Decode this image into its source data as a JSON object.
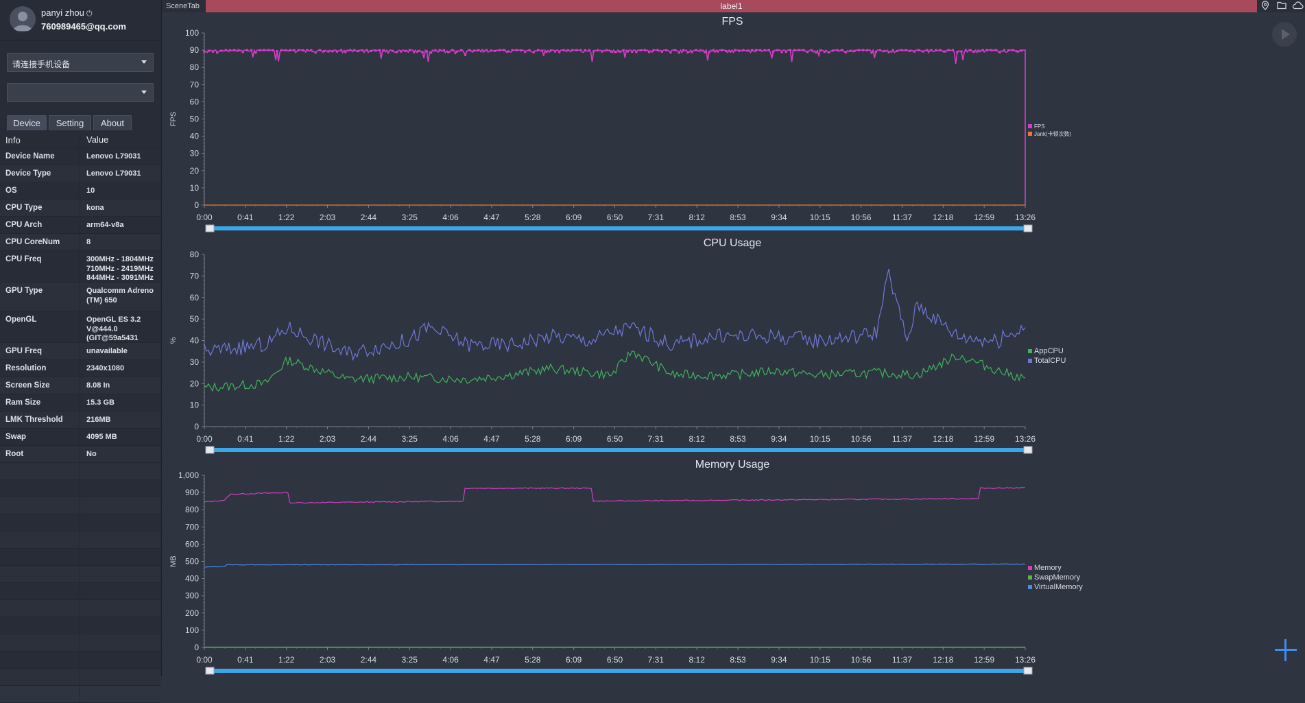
{
  "profile": {
    "username": "panyi zhou",
    "email": "760989465@qq.com"
  },
  "device_select": {
    "value": "请连接手机设备"
  },
  "app_select": {
    "value": ""
  },
  "tabs": [
    {
      "label": "Device",
      "active": true
    },
    {
      "label": "Setting",
      "active": false
    },
    {
      "label": "About",
      "active": false
    }
  ],
  "info_table": {
    "header": {
      "key": "Info",
      "value": "Value"
    },
    "rows": [
      {
        "key": "Device Name",
        "value": [
          "Lenovo L79031"
        ]
      },
      {
        "key": "Device Type",
        "value": [
          "Lenovo L79031"
        ]
      },
      {
        "key": "OS",
        "value": [
          "10"
        ]
      },
      {
        "key": "CPU Type",
        "value": [
          "kona"
        ]
      },
      {
        "key": "CPU Arch",
        "value": [
          "arm64-v8a"
        ]
      },
      {
        "key": "CPU CoreNum",
        "value": [
          "8"
        ]
      },
      {
        "key": "CPU Freq",
        "value": [
          "300MHz - 1804MHz",
          "710MHz - 2419MHz",
          "844MHz - 3091MHz"
        ]
      },
      {
        "key": "GPU Type",
        "value": [
          "Qualcomm Adreno",
          "(TM) 650"
        ]
      },
      {
        "key": "OpenGL",
        "value": [
          "OpenGL ES 3.2",
          "V@444.0",
          "(GIT@59a5431"
        ]
      },
      {
        "key": "GPU Freq",
        "value": [
          "unavailable"
        ]
      },
      {
        "key": "Resolution",
        "value": [
          "2340x1080"
        ]
      },
      {
        "key": "Screen Size",
        "value": [
          "8.08 In"
        ]
      },
      {
        "key": "Ram Size",
        "value": [
          "15.3 GB"
        ]
      },
      {
        "key": "LMK Threshold",
        "value": [
          "216MB"
        ]
      },
      {
        "key": "Swap",
        "value": [
          "4095 MB"
        ]
      },
      {
        "key": "Root",
        "value": [
          "No"
        ]
      }
    ]
  },
  "topbar": {
    "scene_tab": "SceneTab",
    "label": "label1"
  },
  "icons": {
    "location": "location-pin-icon",
    "folder": "folder-icon",
    "cloud": "cloud-icon",
    "play": "play-icon",
    "add": "plus-icon"
  },
  "colors": {
    "label_bar": "#a74a5c",
    "fps": "#d63cc8",
    "jank": "#e8793a",
    "app_cpu": "#3fb35a",
    "total_cpu": "#6f78d8",
    "memory": "#d23fc0",
    "swap": "#5ab83c",
    "virtual": "#4a8de6",
    "scrollbar": "#3aa8e6"
  },
  "chart_data": [
    {
      "type": "line",
      "title": "FPS",
      "ylabel": "FPS",
      "ylim": [
        0,
        100
      ],
      "yticks": [
        "100",
        "90",
        "80",
        "70",
        "60",
        "50",
        "40",
        "30",
        "20",
        "10",
        "0"
      ],
      "xticks": [
        "0:00",
        "0:41",
        "1:22",
        "2:03",
        "2:44",
        "3:25",
        "4:06",
        "4:47",
        "5:28",
        "6:09",
        "6:50",
        "7:31",
        "8:12",
        "8:53",
        "9:34",
        "10:15",
        "10:56",
        "11:37",
        "12:18",
        "12:59",
        "13:26"
      ],
      "x_range_seconds": [
        0,
        806
      ],
      "series": [
        {
          "name": "FPS",
          "value_mean": 90,
          "end_value": 0,
          "markers": true
        },
        {
          "name": "Jank(卡顿次数)",
          "value_mean": 0
        }
      ],
      "legend": "right"
    },
    {
      "type": "line",
      "title": "CPU Usage",
      "ylabel": "%",
      "ylim": [
        0,
        80
      ],
      "yticks": [
        "80",
        "70",
        "60",
        "50",
        "40",
        "30",
        "20",
        "10",
        "0"
      ],
      "xticks": [
        "0:00",
        "0:41",
        "1:22",
        "2:03",
        "2:44",
        "3:25",
        "4:06",
        "4:47",
        "5:28",
        "6:09",
        "6:50",
        "7:31",
        "8:12",
        "8:53",
        "9:34",
        "10:15",
        "10:56",
        "11:37",
        "12:18",
        "12:59",
        "13:26"
      ],
      "x_range_seconds": [
        0,
        806
      ],
      "series": [
        {
          "name": "AppCPU",
          "x": [
            0,
            60,
            82,
            140,
            200,
            260,
            300,
            340,
            400,
            420,
            460,
            520,
            560,
            600,
            660,
            700,
            740,
            780,
            806
          ],
          "values": [
            18,
            20,
            31,
            22,
            23,
            22,
            24,
            27,
            24,
            35,
            24,
            24,
            26,
            24,
            25,
            24,
            33,
            26,
            22
          ]
        },
        {
          "name": "TotalCPU",
          "x": [
            0,
            60,
            82,
            140,
            200,
            220,
            260,
            300,
            340,
            380,
            400,
            420,
            460,
            500,
            560,
            600,
            640,
            660,
            672,
            690,
            700,
            740,
            780,
            806
          ],
          "values": [
            35,
            38,
            46,
            34,
            40,
            46,
            38,
            38,
            42,
            40,
            44,
            46,
            38,
            42,
            42,
            40,
            42,
            44,
            71,
            40,
            57,
            42,
            40,
            47
          ]
        }
      ],
      "legend": "right"
    },
    {
      "type": "line",
      "title": "Memory Usage",
      "ylabel": "MB",
      "ylim": [
        0,
        1000
      ],
      "yticks": [
        "1,000",
        "900",
        "800",
        "700",
        "600",
        "500",
        "400",
        "300",
        "200",
        "100",
        "0"
      ],
      "xticks": [
        "0:00",
        "0:41",
        "1:22",
        "2:03",
        "2:44",
        "3:25",
        "4:06",
        "4:47",
        "5:28",
        "6:09",
        "6:50",
        "7:31",
        "8:12",
        "8:53",
        "9:34",
        "10:15",
        "10:56",
        "11:37",
        "12:18",
        "12:59",
        "13:26"
      ],
      "x_range_seconds": [
        0,
        806
      ],
      "series": [
        {
          "name": "Memory",
          "x": [
            0,
            20,
            25,
            82,
            83,
            255,
            256,
            380,
            381,
            760,
            761,
            806
          ],
          "values": [
            845,
            855,
            890,
            900,
            840,
            850,
            925,
            925,
            850,
            865,
            925,
            928
          ]
        },
        {
          "name": "SwapMemory",
          "x": [
            0,
            806
          ],
          "values": [
            2,
            2
          ]
        },
        {
          "name": "VirtualMemory",
          "x": [
            0,
            20,
            22,
            806
          ],
          "values": [
            468,
            470,
            480,
            484
          ]
        }
      ],
      "legend": "right"
    }
  ]
}
